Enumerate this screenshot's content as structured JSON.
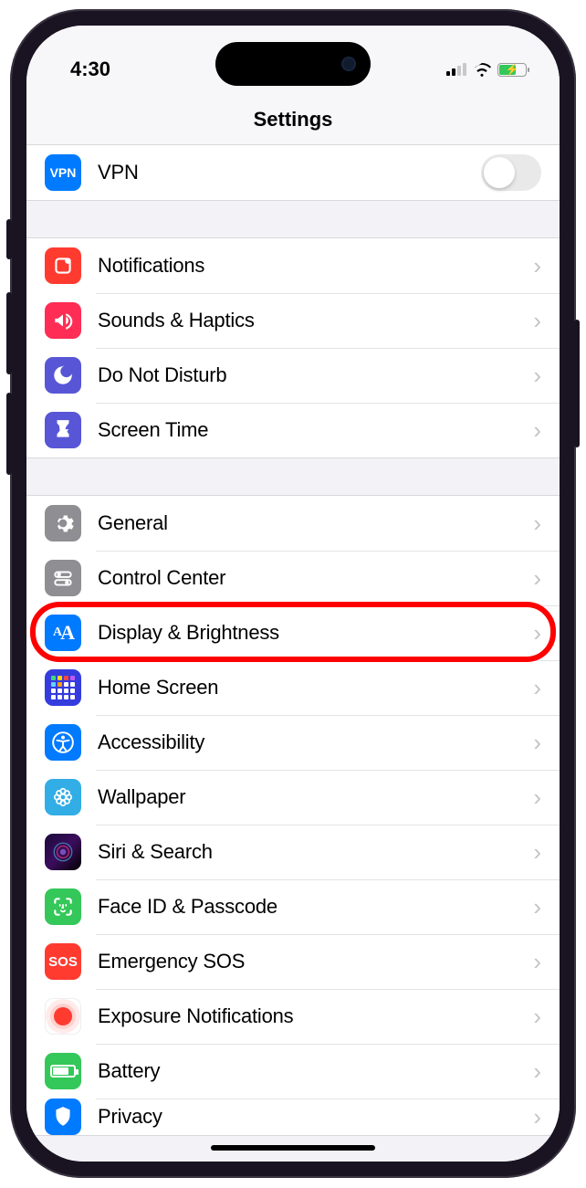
{
  "status": {
    "time": "4:30"
  },
  "header": {
    "title": "Settings"
  },
  "groups": [
    {
      "rows": [
        {
          "id": "vpn",
          "label": "VPN",
          "icon": "vpn",
          "accessory": "toggle"
        }
      ]
    },
    {
      "rows": [
        {
          "id": "notifications",
          "label": "Notifications",
          "icon": "notifications",
          "accessory": "disclosure"
        },
        {
          "id": "sounds",
          "label": "Sounds & Haptics",
          "icon": "sounds",
          "accessory": "disclosure"
        },
        {
          "id": "dnd",
          "label": "Do Not Disturb",
          "icon": "dnd",
          "accessory": "disclosure"
        },
        {
          "id": "screentime",
          "label": "Screen Time",
          "icon": "screentime",
          "accessory": "disclosure"
        }
      ]
    },
    {
      "rows": [
        {
          "id": "general",
          "label": "General",
          "icon": "general",
          "accessory": "disclosure"
        },
        {
          "id": "controlcenter",
          "label": "Control Center",
          "icon": "controlcenter",
          "accessory": "disclosure"
        },
        {
          "id": "display",
          "label": "Display & Brightness",
          "icon": "display",
          "accessory": "disclosure",
          "highlighted": true
        },
        {
          "id": "homescreen",
          "label": "Home Screen",
          "icon": "homescreen",
          "accessory": "disclosure"
        },
        {
          "id": "accessibility",
          "label": "Accessibility",
          "icon": "accessibility",
          "accessory": "disclosure"
        },
        {
          "id": "wallpaper",
          "label": "Wallpaper",
          "icon": "wallpaper",
          "accessory": "disclosure"
        },
        {
          "id": "siri",
          "label": "Siri & Search",
          "icon": "siri",
          "accessory": "disclosure"
        },
        {
          "id": "faceid",
          "label": "Face ID & Passcode",
          "icon": "faceid",
          "accessory": "disclosure"
        },
        {
          "id": "sos",
          "label": "Emergency SOS",
          "icon": "sos",
          "accessory": "disclosure"
        },
        {
          "id": "exposure",
          "label": "Exposure Notifications",
          "icon": "exposure",
          "accessory": "disclosure"
        },
        {
          "id": "battery",
          "label": "Battery",
          "icon": "battery",
          "accessory": "disclosure"
        },
        {
          "id": "privacy",
          "label": "Privacy",
          "icon": "privacy",
          "accessory": "disclosure"
        }
      ]
    }
  ],
  "iconText": {
    "vpn": "VPN",
    "sos": "SOS"
  }
}
